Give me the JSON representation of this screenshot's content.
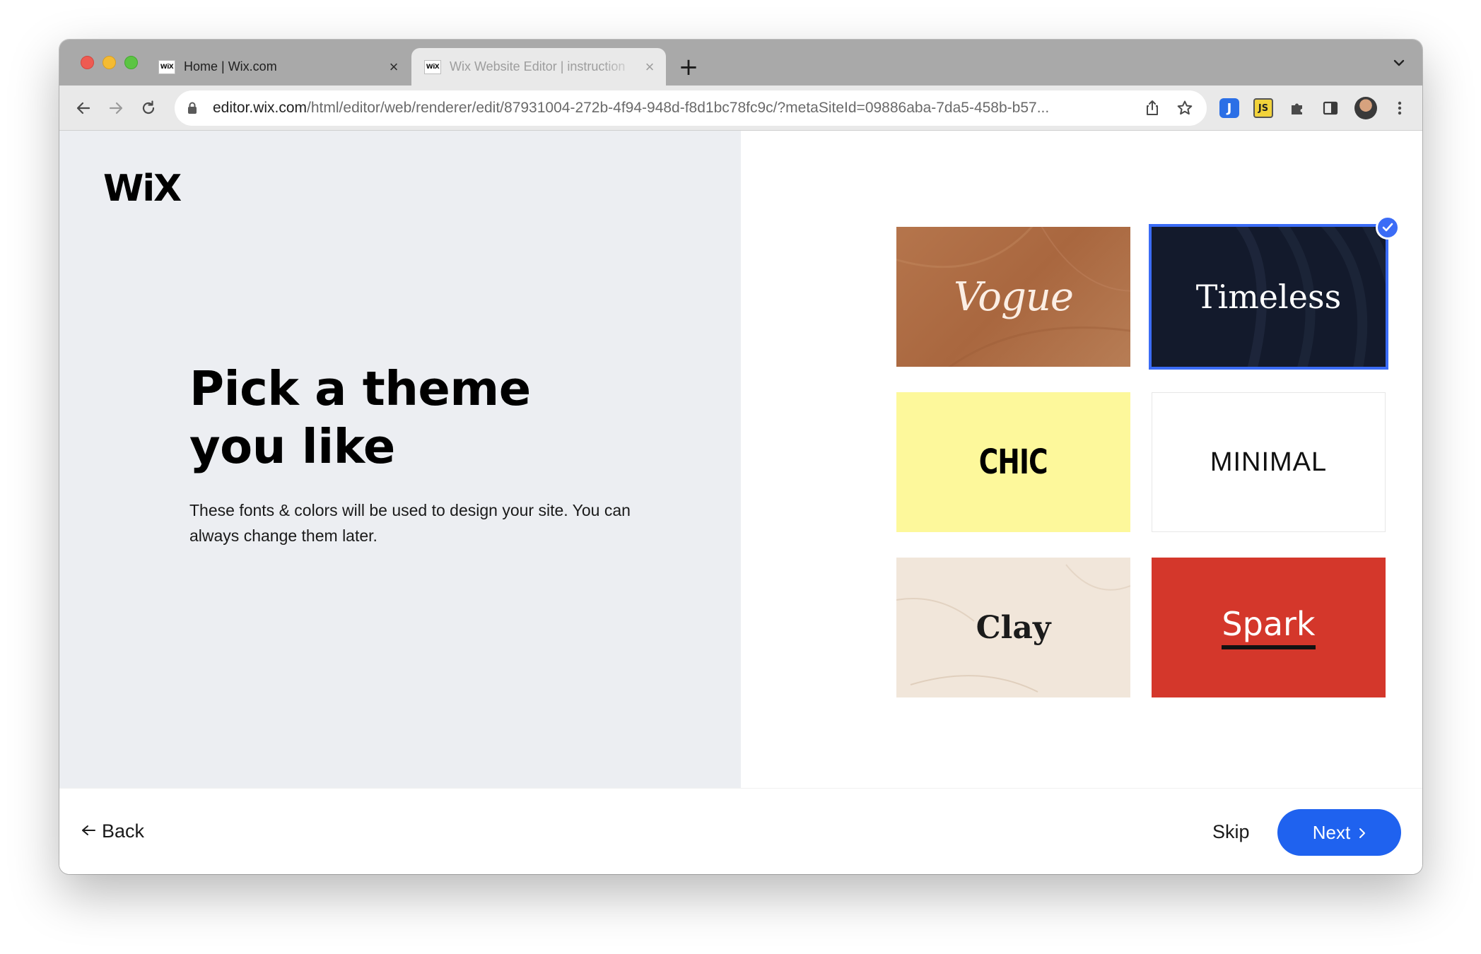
{
  "browser": {
    "tabs": [
      {
        "favicon": "WiX",
        "title": "Home | Wix.com",
        "active": true
      },
      {
        "favicon": "WiX",
        "title": "Wix Website Editor | instruction",
        "active": false
      }
    ],
    "new_tab": "+",
    "url_host": "editor.wix.com",
    "url_path": "/html/editor/web/renderer/edit/87931004-272b-4f94-948d-f8d1bc78fc9c/?metaSiteId=09886aba-7da5-458b-b57...",
    "extensions": {
      "j_label": "J",
      "js_label": "JS"
    },
    "icons": [
      "back-arrow-icon",
      "forward-arrow-icon",
      "reload-icon",
      "lock-icon",
      "share-icon",
      "star-icon",
      "puzzle-icon",
      "sidepanel-icon",
      "profile-avatar",
      "kebab-menu-icon"
    ],
    "traffic_light_colors": {
      "close": "#ee5b52",
      "minimize": "#f4bb33",
      "maximize": "#5cc443"
    }
  },
  "page": {
    "logo": "WiX",
    "headline": "Pick a theme you like",
    "description": "These fonts & colors will be used to design your site. You can always change them later.",
    "themes": [
      {
        "name": "Vogue",
        "selected": false,
        "color": "#b06f47"
      },
      {
        "name": "Timeless",
        "selected": true,
        "color": "#131a2c"
      },
      {
        "name": "CHIC",
        "selected": false,
        "color": "#fdf89b"
      },
      {
        "name": "MINIMAL",
        "selected": false,
        "color": "#ffffff"
      },
      {
        "name": "Clay",
        "selected": false,
        "color": "#f1e6da"
      },
      {
        "name": "Spark",
        "selected": false,
        "color": "#d4372b"
      }
    ],
    "accent_color": "#1f62ef"
  },
  "footer": {
    "back_label": "Back",
    "skip_label": "Skip",
    "next_label": "Next"
  }
}
